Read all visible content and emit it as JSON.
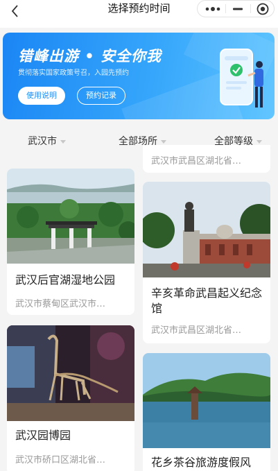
{
  "nav": {
    "title": "选择预约时间",
    "back_icon": "chevron-left-icon",
    "more_icon": "more-dots-icon",
    "minimize_icon": "minimize-icon",
    "close_icon": "target-close-icon"
  },
  "banner": {
    "title": "错峰出游 • 安全你我",
    "subtitle": "贯彻落实国家政策号召，入园先预约",
    "usage_button": "使用说明",
    "records_button": "预约记录",
    "colors": {
      "start": "#1b86f4",
      "end": "#62c6ff"
    }
  },
  "filters": [
    {
      "label": "武汉市"
    },
    {
      "label": "全部场所"
    },
    {
      "label": "全部等级"
    }
  ],
  "venues": [
    {
      "name": "",
      "address": "武汉市武昌区湖北省…"
    },
    {
      "name": "武汉后官湖湿地公园",
      "address": "武汉市蔡甸区武汉市…"
    },
    {
      "name": "辛亥革命武昌起义纪念馆",
      "address": "武汉市武昌区湖北省…"
    },
    {
      "name": "武汉园博园",
      "address": "武汉市硚口区湖北省…"
    },
    {
      "name": "花乡茶谷旅游度假风",
      "address": ""
    }
  ],
  "colors": {
    "accent": "#1c8cf5",
    "page_bg": "#f4f4f4"
  }
}
